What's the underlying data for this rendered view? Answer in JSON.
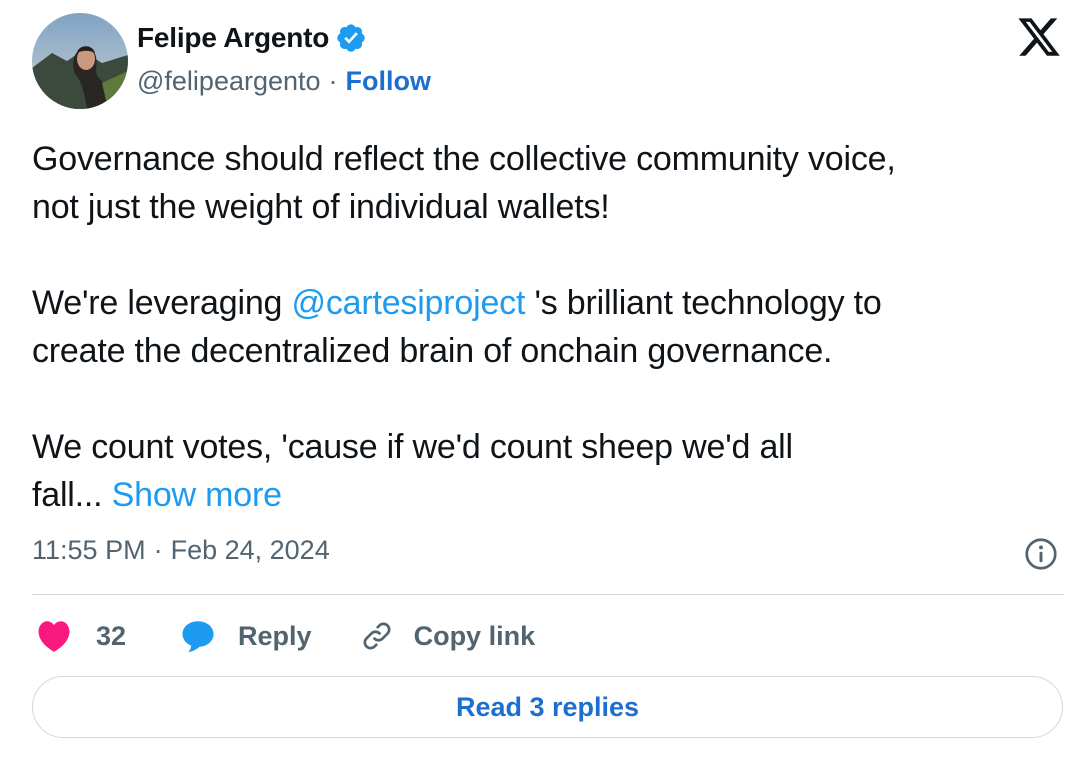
{
  "author": {
    "display_name": "Felipe Argento",
    "handle": "@felipeargento",
    "separator": "·",
    "follow_label": "Follow",
    "verified": true
  },
  "tweet": {
    "para1_line1": "Governance should reflect the collective community voice,",
    "para1_line2": "not just the weight of individual wallets!",
    "para2_prefix": "We're leveraging ",
    "para2_mention": "@cartesiproject",
    "para2_suffix": " 's brilliant technology to",
    "para2_line2": "create the decentralized brain of onchain governance.",
    "para3_line1": "We count votes, 'cause if we'd count sheep we'd all",
    "para3_line2": "fall...",
    "show_more_label": "Show more"
  },
  "meta": {
    "time": "11:55 PM",
    "separator": "·",
    "date": "Feb 24, 2024"
  },
  "actions": {
    "like_count": "32",
    "reply_label": "Reply",
    "copy_link_label": "Copy link"
  },
  "read_replies_label": "Read 3 replies",
  "icons": {
    "brand": "x-logo-icon",
    "verified": "verified-badge-icon",
    "info": "info-icon",
    "like": "heart-icon",
    "reply": "speech-bubble-icon",
    "copy": "link-icon"
  },
  "colors": {
    "link_blue": "#1d9bf0",
    "follow_blue": "#1d6fcf",
    "heart_pink": "#f91880",
    "muted_gray": "#536471",
    "border_gray": "#cfd9de"
  }
}
